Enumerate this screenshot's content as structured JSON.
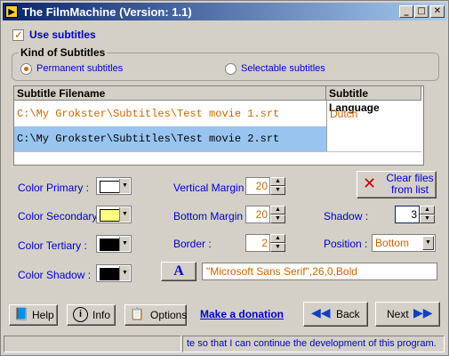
{
  "window": {
    "title": "The FilmMachine  (Version: 1.1)"
  },
  "use_subtitles": {
    "label": "Use subtitles",
    "checked": true
  },
  "kind": {
    "heading": "Kind of Subtitles",
    "permanent_label": "Permanent subtitles",
    "selectable_label": "Selectable subtitles",
    "selected": "permanent"
  },
  "table": {
    "col_filename": "Subtitle Filename",
    "col_language": "Subtitle Language",
    "rows": [
      {
        "filename": "C:\\My Grokster\\Subtitles\\Test movie 1.srt",
        "language": "Dutch"
      },
      {
        "filename": "C:\\My Grokster\\Subtitles\\Test movie 2.srt",
        "language": ""
      }
    ]
  },
  "colors": {
    "primary_label": "Color Primary :",
    "secondary_label": "Color Secondary :",
    "tertiary_label": "Color Tertiary :",
    "shadow_label": "Color Shadow :",
    "primary_value": "#ffffff",
    "secondary_value": "#ffff80",
    "tertiary_value": "#000000",
    "shadow_value": "#000000"
  },
  "margins": {
    "vertical_label": "Vertical Margin :",
    "vertical_value": "20",
    "bottom_label": "Bottom Margin :",
    "bottom_value": "20",
    "border_label": "Border :",
    "border_value": "2"
  },
  "right": {
    "clear_label_1": "Clear files",
    "clear_label_2": "from list",
    "shadow_label": "Shadow :",
    "shadow_value": "3",
    "position_label": "Position :",
    "position_value": "Bottom"
  },
  "font": {
    "button_glyph": "A",
    "value": "\"Microsoft Sans Serif\",26,0,Bold"
  },
  "buttons": {
    "help": "Help",
    "info": "Info",
    "options": "Options",
    "donation": "Make a donation",
    "back": "Back",
    "next": "Next"
  },
  "status": {
    "text": "te so that I can continue the development of this program."
  },
  "accent": {
    "label_blue": "#0000cc",
    "value_orange": "#cc6600",
    "selection": "#99c4f0"
  }
}
